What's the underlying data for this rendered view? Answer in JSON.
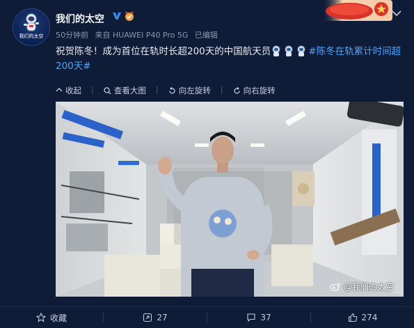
{
  "account": {
    "name": "我们的太空",
    "avatar_label": "我们的太空",
    "time": "50分钟前",
    "source": "来自 HUAWEI P40 Pro 5G",
    "edited": "已编辑"
  },
  "post": {
    "text_prefix": "祝贺陈冬！成为首位在轨时长超200天的中国航天员",
    "hashtag": "#陈冬在轨累计时间超200天#",
    "emoji": "astronaut-emoji"
  },
  "image_toolbar": {
    "collapse": "收起",
    "view_large": "查看大图",
    "rotate_left": "向左旋转",
    "rotate_right": "向右旋转"
  },
  "photo": {
    "watermark": "@我们的太空"
  },
  "footer": {
    "favorite": "收藏",
    "repost_count": "27",
    "comment_count": "37",
    "like_count": "274"
  },
  "colors": {
    "background": "#0f1c37",
    "hashtag": "#4fa3ff",
    "verified": "#2f8df6"
  }
}
